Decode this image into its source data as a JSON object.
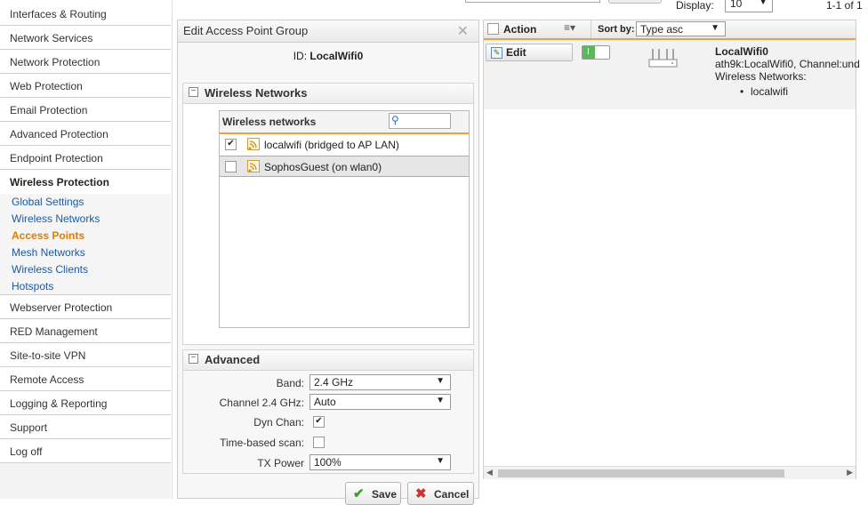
{
  "sidebar": {
    "items": [
      {
        "label": "Interfaces & Routing"
      },
      {
        "label": "Network Services"
      },
      {
        "label": "Network Protection"
      },
      {
        "label": "Web Protection"
      },
      {
        "label": "Email Protection"
      },
      {
        "label": "Advanced Protection"
      },
      {
        "label": "Endpoint Protection"
      },
      {
        "label": "Wireless Protection"
      }
    ],
    "sub_items": [
      {
        "label": "Global Settings"
      },
      {
        "label": "Wireless Networks"
      },
      {
        "label": "Access Points"
      },
      {
        "label": "Mesh Networks"
      },
      {
        "label": "Wireless Clients"
      },
      {
        "label": "Hotspots"
      }
    ],
    "items_after": [
      {
        "label": "Webserver Protection"
      },
      {
        "label": "RED Management"
      },
      {
        "label": "Site-to-site VPN"
      },
      {
        "label": "Remote Access"
      },
      {
        "label": "Logging & Reporting"
      },
      {
        "label": "Support"
      },
      {
        "label": "Log off"
      }
    ]
  },
  "dialog": {
    "title": "Edit Access Point Group",
    "id_label": "ID:",
    "id_value": "LocalWifi0",
    "wireless_section": {
      "title": "Wireless Networks",
      "list_header": "Wireless networks",
      "rows": [
        {
          "label": "localwifi (bridged to AP LAN)",
          "checked": "✔"
        },
        {
          "label": "SophosGuest (on wlan0)",
          "checked": ""
        }
      ]
    },
    "advanced_section": {
      "title": "Advanced",
      "band_label": "Band:",
      "band_value": "2.4 GHz",
      "channel_label": "Channel 2.4 GHz:",
      "channel_value": "Auto",
      "dynchan_label": "Dyn Chan:",
      "dynchan_checked": "✔",
      "timescan_label": "Time-based scan:",
      "timescan_checked": "",
      "txpower_label": "TX Power",
      "txpower_value": "100%"
    },
    "save_label": "Save",
    "cancel_label": "Cancel"
  },
  "toolbar": {
    "display_label": "Display:",
    "display_value": "10",
    "range_text": "1-1 of 1"
  },
  "list": {
    "action_label": "Action",
    "sortby_label": "Sort by:",
    "sort_value": "Type asc",
    "entry": {
      "edit_label": "Edit",
      "name": "LocalWifi0",
      "detail": "ath9k:LocalWifi0, Channel:und",
      "networks_label": "Wireless Networks:",
      "network_item": "localwifi"
    }
  },
  "colors": {
    "accent": "#f39c3c",
    "link": "#1a5aa6",
    "current": "#e07b00",
    "toggle_on": "#5cb85c"
  }
}
